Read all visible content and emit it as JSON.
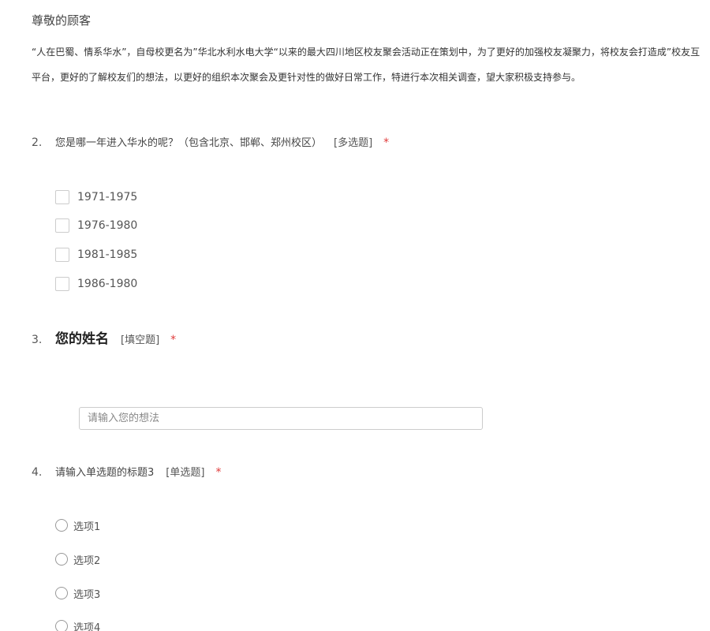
{
  "header": {
    "greeting": "尊敬的顾客",
    "intro_line1": "“人在巴蜀、情系华水”，自母校更名为”华北水利水电大学“以来的最大四川地区校友聚会活动正在策划中，为了更好的加强校友凝聚力，将校友会打造成”校友互",
    "intro_line2": "平台，更好的了解校友们的想法，以更好的组织本次聚会及更针对性的做好日常工作，特进行本次相关调查，望大家积极支持参与。"
  },
  "questions": [
    {
      "number": "2.",
      "title": "您是哪一年进入华水的呢？（包含北京、邯郸、郑州校区）",
      "type": "[多选题]",
      "required": "*",
      "options": [
        "1971-1975",
        "1976-1980",
        "1981-1985",
        "1986-1980"
      ]
    },
    {
      "number": "3.",
      "title": "您的姓名",
      "type": "[填空题]",
      "required": "*",
      "placeholder": "请输入您的想法"
    },
    {
      "number": "4.",
      "title": "请输入单选题的标题3",
      "type": "[单选题]",
      "required": "*",
      "options": [
        "选项1",
        "选项2",
        "选项3",
        "选项4"
      ]
    }
  ]
}
